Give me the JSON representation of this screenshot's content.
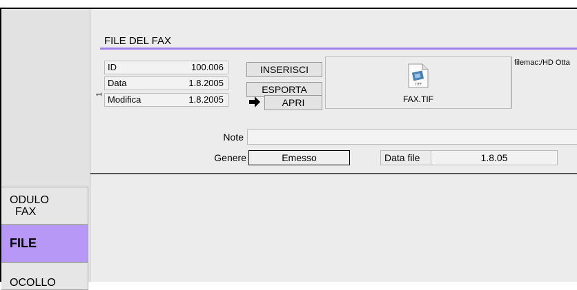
{
  "sidebar": {
    "tabs": [
      {
        "label_line1": "ODULO",
        "label_line2": "FAX"
      },
      {
        "label": "FILE"
      },
      {
        "label": "OCOLLO"
      }
    ]
  },
  "section": {
    "title": "FILE DEL FAX"
  },
  "fields": {
    "id": {
      "label": "ID",
      "value": "100.006"
    },
    "data": {
      "label": "Data",
      "value": "1.8.2005"
    },
    "modifica": {
      "label": "Modifica",
      "value": "1.8.2005"
    }
  },
  "buttons": {
    "inserisci": "INSERISCI",
    "esporta": "ESPORTA",
    "apri": "APRI"
  },
  "preview": {
    "filename": "FAX.TIF",
    "icon_badge": "TIFF",
    "path": "filemac:/HD Otta"
  },
  "side_number": "1",
  "note": {
    "label": "Note",
    "value": ""
  },
  "genere": {
    "label": "Genere",
    "value": "Emesso"
  },
  "data_file": {
    "label": "Data file",
    "value": "1.8.05"
  },
  "colors": {
    "accent": "#9d7ff0",
    "active_tab": "#b798f6"
  }
}
